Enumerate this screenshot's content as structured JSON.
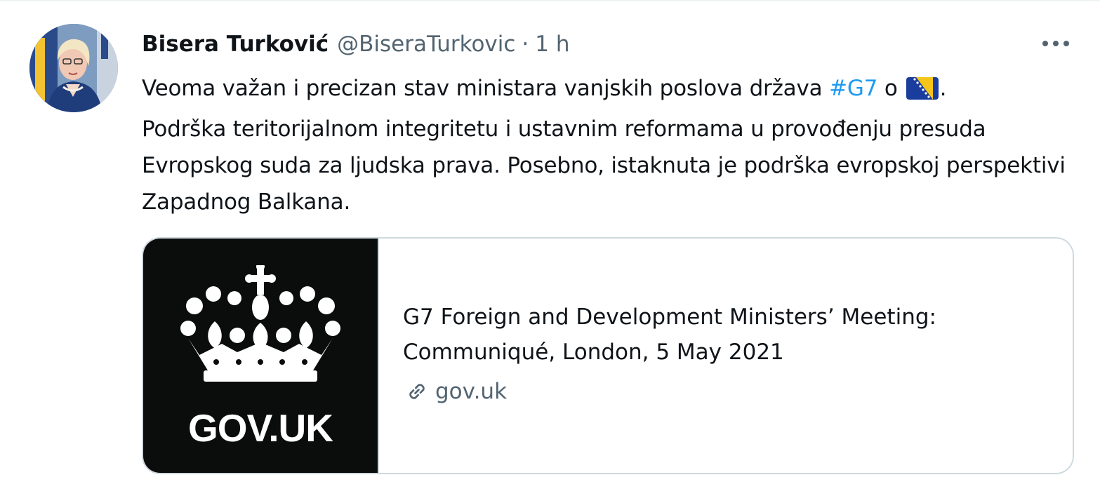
{
  "tweet": {
    "author_name": "Bisera Turković",
    "handle": "@BiseraTurkovic",
    "separator": "·",
    "time": "1 h",
    "text_part1": "Veoma važan i precizan stav ministara vanjskih poslova država ",
    "hashtag": "#G7",
    "text_part2": " o",
    "text_part3": ".",
    "text_part4": "Podrška teritorijalnom integritetu i ustavnim reformama u provođenju presuda Evropskog suda za ljudska prava. Posebno, istaknuta je podrška evropskoj perspektivi Zapadnog Balkana."
  },
  "card": {
    "image_text": "GOV.UK",
    "title": "G7 Foreign and Development Ministers’ Meeting: Communiqué, London, 5 May 2021",
    "domain": "gov.uk"
  },
  "icons": {
    "more": "more-horizontal-icon",
    "link": "link-icon",
    "flag": "bosnia-flag-emoji",
    "crown": "crown-logo"
  },
  "colors": {
    "hashtag": "#1d9bf0",
    "secondary_text": "#536471",
    "card_border": "#cfd9de",
    "card_image_bg": "#0b0c0c"
  }
}
